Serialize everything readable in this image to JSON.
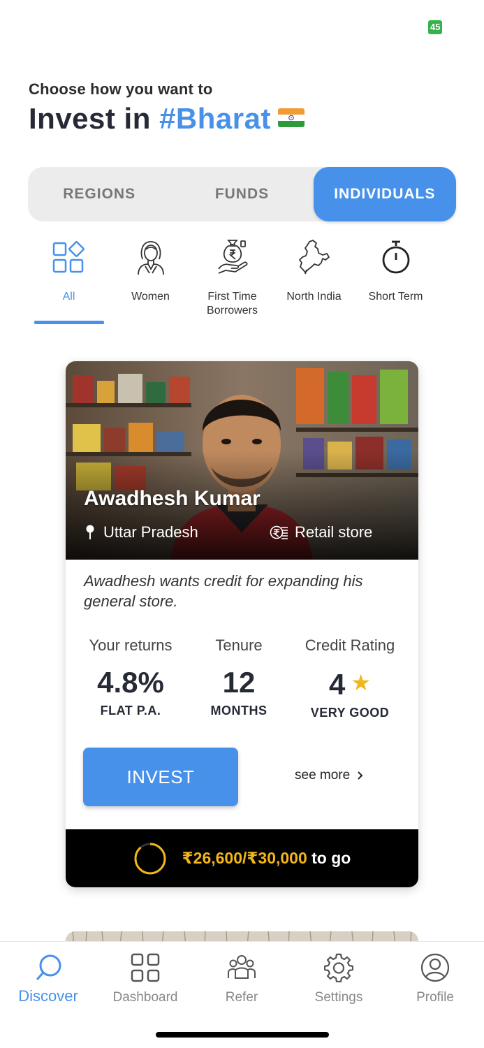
{
  "status": {
    "badge": "45"
  },
  "header": {
    "subtitle": "Choose how you want to",
    "title_prefix": "Invest in ",
    "title_accent": "#Bharat"
  },
  "segments": [
    "REGIONS",
    "FUNDS",
    "INDIVIDUALS"
  ],
  "active_segment": "INDIVIDUALS",
  "categories": [
    {
      "label": "All",
      "icon": "grid-shapes-icon",
      "active": true
    },
    {
      "label": "Women",
      "icon": "woman-icon"
    },
    {
      "label": "First Time Borrowers",
      "icon": "money-hand-icon"
    },
    {
      "label": "North India",
      "icon": "india-map-icon"
    },
    {
      "label": "Short Term",
      "icon": "stopwatch-icon"
    }
  ],
  "card": {
    "name": "Awadhesh Kumar",
    "location": "Uttar Pradesh",
    "business": "Retail store",
    "description": "Awadhesh wants credit for expanding his general store.",
    "stats": {
      "returns": {
        "heading": "Your returns",
        "value": "4.8%",
        "unit": "FLAT P.A."
      },
      "tenure": {
        "heading": "Tenure",
        "value": "12",
        "unit": "MONTHS"
      },
      "rating": {
        "heading": "Credit Rating",
        "value": "4",
        "unit": "VERY GOOD"
      }
    },
    "invest_label": "INVEST",
    "see_more_label": "see more",
    "progress": {
      "amount": "₹26,600/₹30,000",
      "suffix": " to go",
      "fraction": 0.887
    }
  },
  "tabs": [
    {
      "label": "Discover",
      "icon": "search-icon",
      "active": true
    },
    {
      "label": "Dashboard",
      "icon": "dashboard-grid-icon"
    },
    {
      "label": "Refer",
      "icon": "people-group-icon"
    },
    {
      "label": "Settings",
      "icon": "gear-icon"
    },
    {
      "label": "Profile",
      "icon": "user-circle-icon"
    }
  ],
  "colors": {
    "accent": "#4791ea",
    "gold": "#f2b61a",
    "dark_text": "#252a36",
    "status_green": "#33b349"
  }
}
